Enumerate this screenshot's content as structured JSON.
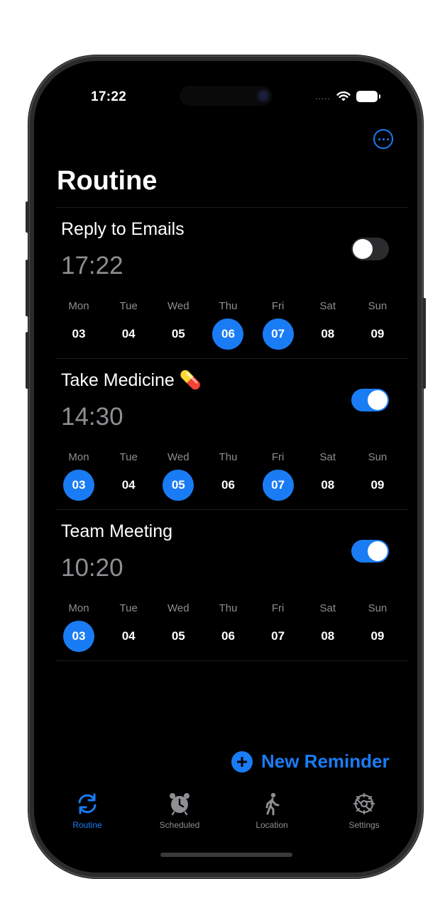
{
  "status_bar": {
    "time": "17:22",
    "signal": "....."
  },
  "header": {
    "title": "Routine"
  },
  "reminders": [
    {
      "title": "Reply to Emails",
      "time": "17:22",
      "enabled": false,
      "days": [
        {
          "name": "Mon",
          "num": "03",
          "active": false
        },
        {
          "name": "Tue",
          "num": "04",
          "active": false
        },
        {
          "name": "Wed",
          "num": "05",
          "active": false
        },
        {
          "name": "Thu",
          "num": "06",
          "active": true
        },
        {
          "name": "Fri",
          "num": "07",
          "active": true
        },
        {
          "name": "Sat",
          "num": "08",
          "active": false
        },
        {
          "name": "Sun",
          "num": "09",
          "active": false
        }
      ]
    },
    {
      "title": "Take Medicine 💊",
      "time": "14:30",
      "enabled": true,
      "days": [
        {
          "name": "Mon",
          "num": "03",
          "active": true
        },
        {
          "name": "Tue",
          "num": "04",
          "active": false
        },
        {
          "name": "Wed",
          "num": "05",
          "active": true
        },
        {
          "name": "Thu",
          "num": "06",
          "active": false
        },
        {
          "name": "Fri",
          "num": "07",
          "active": true
        },
        {
          "name": "Sat",
          "num": "08",
          "active": false
        },
        {
          "name": "Sun",
          "num": "09",
          "active": false
        }
      ]
    },
    {
      "title": "Team Meeting",
      "time": "10:20",
      "enabled": true,
      "days": [
        {
          "name": "Mon",
          "num": "03",
          "active": true
        },
        {
          "name": "Tue",
          "num": "04",
          "active": false
        },
        {
          "name": "Wed",
          "num": "05",
          "active": false
        },
        {
          "name": "Thu",
          "num": "06",
          "active": false
        },
        {
          "name": "Fri",
          "num": "07",
          "active": false
        },
        {
          "name": "Sat",
          "num": "08",
          "active": false
        },
        {
          "name": "Sun",
          "num": "09",
          "active": false
        }
      ]
    }
  ],
  "actions": {
    "new_reminder": "New Reminder"
  },
  "tabs": [
    {
      "label": "Routine",
      "icon": "refresh-icon",
      "active": true
    },
    {
      "label": "Scheduled",
      "icon": "alarm-clock-icon",
      "active": false
    },
    {
      "label": "Location",
      "icon": "walking-person-icon",
      "active": false
    },
    {
      "label": "Settings",
      "icon": "gear-icon",
      "active": false
    }
  ],
  "colors": {
    "accent": "#1a7cf5",
    "background": "#000000",
    "secondary_text": "#8e8e93"
  }
}
